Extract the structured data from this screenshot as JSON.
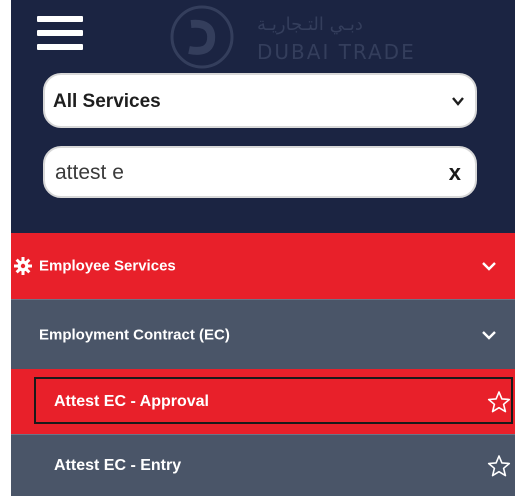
{
  "brand": {
    "name_en": "DUBAI TRADE",
    "name_ar": "دبـي التـجاريـة"
  },
  "filters": {
    "service_select": {
      "selected": "All Services"
    },
    "search": {
      "value": "attest e",
      "clear_label": "x"
    }
  },
  "menu": [
    {
      "label": "Employee Services",
      "icon": "gear-icon",
      "expanded": true
    },
    {
      "label": "Employment Contract (EC)",
      "expanded": true
    },
    {
      "label": "Attest EC - Approval",
      "favorite_icon": "star-outline-icon",
      "selected": true
    },
    {
      "label": "Attest EC - Entry",
      "favorite_icon": "star-outline-icon"
    }
  ],
  "colors": {
    "header_bg": "#1b2442",
    "active_red": "#e8202a",
    "submenu_gray": "#4a5568",
    "white": "#ffffff"
  }
}
